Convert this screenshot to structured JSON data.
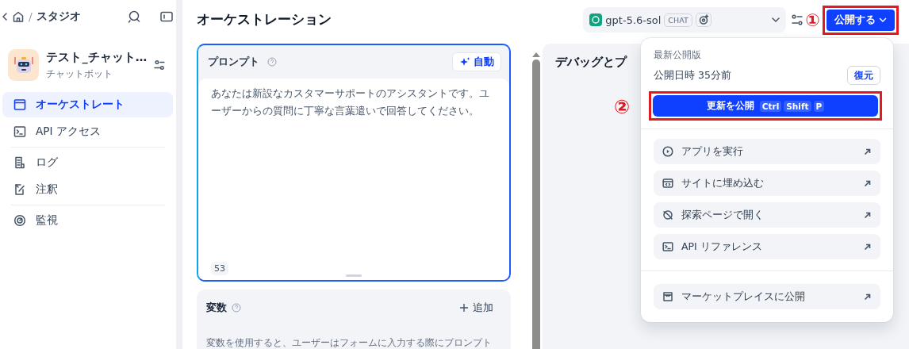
{
  "breadcrumb": {
    "separator": "/",
    "current": "スタジオ"
  },
  "app": {
    "name": "テスト_チャット…",
    "type": "チャットボット"
  },
  "sidebar": {
    "groups": [
      [
        {
          "label": "オーケストレート",
          "selected": true
        },
        {
          "label": "API アクセス",
          "selected": false
        }
      ],
      [
        {
          "label": "ログ",
          "selected": false
        },
        {
          "label": "注釈",
          "selected": false
        }
      ],
      [
        {
          "label": "監視",
          "selected": false
        }
      ]
    ]
  },
  "page_title": "オーケストレーション",
  "model_selector": {
    "name": "gpt-5.6-sol",
    "badge": "CHAT"
  },
  "publish_button": {
    "label": "公開する",
    "expanded": true
  },
  "prompt_panel": {
    "title": "プロンプト",
    "auto_button": "自動",
    "text": "あなたは新設なカスタマーサポートのアシスタントです。ユーザーからの質問に丁寧な言葉遣いで回答してください。",
    "char_count": "53"
  },
  "variables_panel": {
    "title": "変数",
    "add_button": "追加",
    "description": "変数を使用すると、ユーザーはフォームに入力する際にプロンプト"
  },
  "debug_panel": {
    "title": "デバッグとプ"
  },
  "publish_menu": {
    "heading": "最新公開版",
    "published_time": "公開日時 35分前",
    "restore_button": "復元",
    "update_button": {
      "label": "更新を公開",
      "shortcut": [
        "Ctrl",
        "Shift",
        "P"
      ]
    },
    "actions": [
      {
        "label": "アプリを実行"
      },
      {
        "label": "サイトに埋め込む"
      },
      {
        "label": "探索ページで開く"
      },
      {
        "label": "API リファレンス"
      }
    ],
    "marketplace": {
      "label": "マーケットプレイスに公開"
    }
  },
  "annotations": [
    {
      "label": "①"
    },
    {
      "label": "②"
    }
  ]
}
